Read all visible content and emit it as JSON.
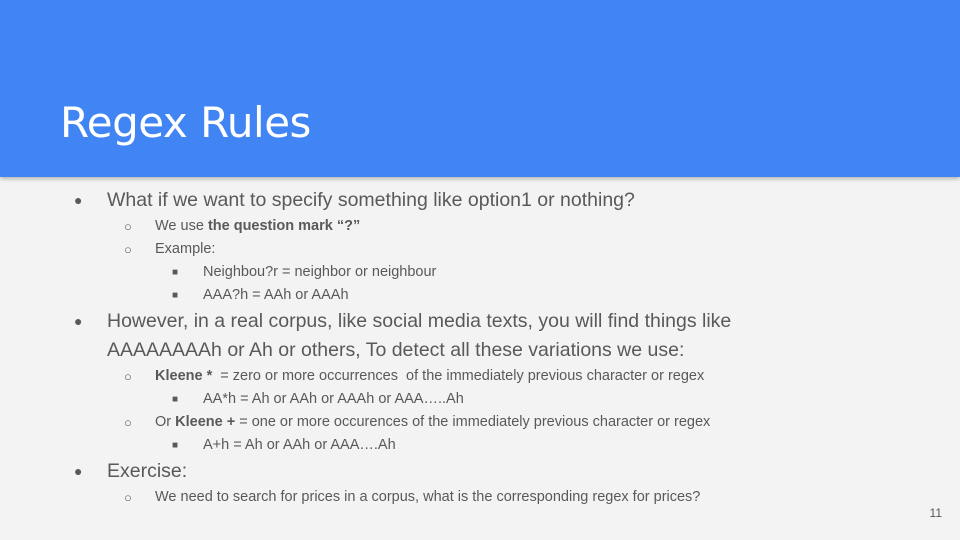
{
  "slide": {
    "title": "Regex Rules",
    "page_number": "11",
    "bullets": {
      "b1": "What if we want to specify something like option1 or nothing?",
      "b1_1_pre": "We use ",
      "b1_1_bold": "the question mark “?”",
      "b1_2": "Example:",
      "b1_2_1": "Neighbou?r = neighbor or neighbour",
      "b1_2_2": "AAA?h = AAh or AAAh",
      "b2_line1": "However, in a real corpus, like social media texts, you will find things like",
      "b2_line2": "AAAAAAAAh or Ah or others, To detect all these variations we use:",
      "b2_1_bold": "Kleene *",
      "b2_1_rest": "  = zero or more occurrences  of the immediately previous character or regex",
      "b2_1_1": "AA*h = Ah or AAh or AAAh or AAA…..Ah",
      "b2_2_pre": "Or ",
      "b2_2_bold": "Kleene +",
      "b2_2_rest": " = one or more occurences of the immediately previous character or regex",
      "b2_2_1": "A+h = Ah or AAh or AAA….Ah",
      "b3": "Exercise:",
      "b3_1": "We need to search for prices in a corpus, what is the corresponding regex for prices?"
    },
    "markers": {
      "level1": "●",
      "level2": "○",
      "level3": "■"
    }
  }
}
